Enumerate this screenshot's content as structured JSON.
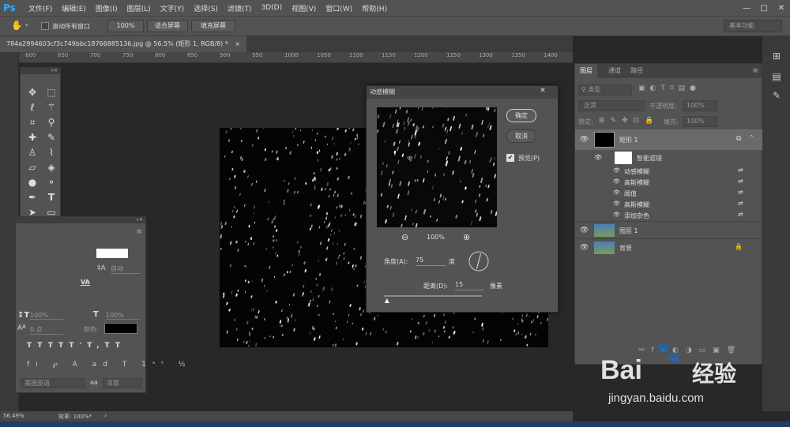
{
  "app": {
    "logo": "Ps"
  },
  "menubar": {
    "items": [
      "文件(F)",
      "编辑(E)",
      "图像(I)",
      "图层(L)",
      "文字(Y)",
      "选择(S)",
      "滤镜(T)",
      "3D(D)",
      "视图(V)",
      "窗口(W)",
      "帮助(H)"
    ],
    "window_controls": {
      "minimize": "—",
      "maximize": "□",
      "close": "✕"
    }
  },
  "options": {
    "scroll_all": "滚动所有窗口",
    "zoom_pct": "100%",
    "fit_screen": "适合屏幕",
    "fill_screen": "填充屏幕",
    "workspace": "基本功能"
  },
  "document": {
    "tab_title": "784a2994603cf3c749bbc18766885136.jpg @ 56.5% (矩形 1, RGB/8) *",
    "close": "×"
  },
  "ruler": {
    "h_ticks": [
      "600",
      "650",
      "700",
      "750",
      "800",
      "850",
      "900",
      "950",
      "1000",
      "1050",
      "1100",
      "1150",
      "1200",
      "1250",
      "1300",
      "1350",
      "1400"
    ]
  },
  "dialog": {
    "title": "动感模糊",
    "ok": "确定",
    "cancel": "取消",
    "preview_label": "预览(P)",
    "preview_checked": true,
    "zoom": "100%",
    "angle_label": "角度(A):",
    "angle_value": "75",
    "angle_unit": "度",
    "distance_label": "距离(D):",
    "distance_value": "15",
    "distance_unit": "像素",
    "slider_fraction": 0.03
  },
  "character": {
    "lang": "美国英语",
    "aa_icon": "aa",
    "aa_mode": "浑厚",
    "color_label": "颜色:",
    "leading": "自动",
    "scale_v": "100%",
    "scale_h": "100%",
    "baseline": "0 点",
    "va_label": "VA"
  },
  "layers": {
    "tabs": [
      "图层",
      "通道",
      "路径"
    ],
    "filter_kind": "类型",
    "blend_mode": "正常",
    "opacity_label": "不透明度:",
    "opacity": "100%",
    "lock_label": "锁定:",
    "fill_label": "填充:",
    "fill": "100%",
    "items": [
      {
        "name": "矩形 1",
        "type": "layer"
      },
      {
        "name": "智能滤镜",
        "type": "smart"
      },
      {
        "name": "动感模糊",
        "type": "filter"
      },
      {
        "name": "高斯模糊",
        "type": "filter"
      },
      {
        "name": "阈值",
        "type": "filter"
      },
      {
        "name": "高斯模糊",
        "type": "filter"
      },
      {
        "name": "添加杂色",
        "type": "filter"
      },
      {
        "name": "图层 1",
        "type": "layer"
      },
      {
        "name": "背景",
        "type": "layer"
      }
    ]
  },
  "status": {
    "zoom": "56.49%",
    "efficiency": "效率: 100%*"
  },
  "watermark": {
    "brand": "Bai",
    "brand2": "经验",
    "url": "jingyan.baidu.com"
  },
  "colors": {
    "accent": "#31a8ff",
    "panel": "#535353",
    "dark": "#282828"
  }
}
